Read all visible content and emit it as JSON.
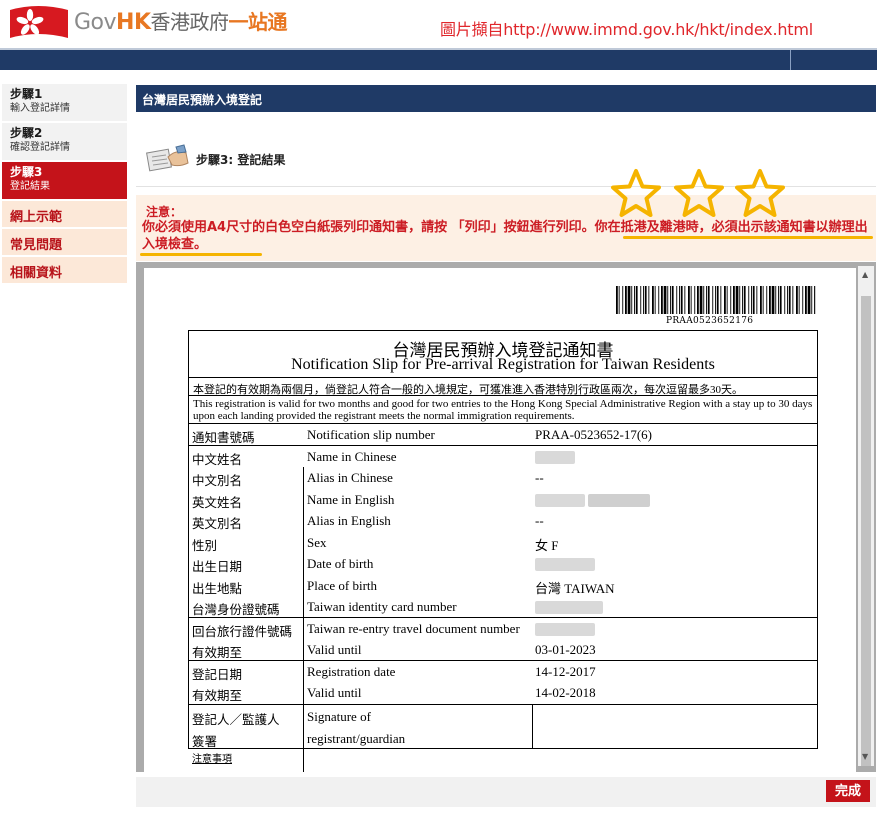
{
  "header": {
    "logo_gov": "Gov",
    "logo_hk": "HK",
    "logo_zh": "香港政府",
    "logo_zh2": "一站通",
    "source_note": "圖片擷自http://www.immd.gov.hk/hkt/index.html"
  },
  "sidebar": {
    "steps": [
      {
        "title": "步驟1",
        "sub": "輸入登記詳情"
      },
      {
        "title": "步驟2",
        "sub": "確認登記詳情"
      },
      {
        "title": "步驟3",
        "sub": "登記結果"
      }
    ],
    "links": [
      "網上示範",
      "常見問題",
      "相關資料"
    ]
  },
  "main": {
    "title_bar": "台灣居民預辦入境登記",
    "step_heading": "步驟3: 登記結果",
    "notice_title": "注意：",
    "notice_text": "你必須使用A4尺寸的白色空白紙張列印通知書，請按 「列印」按鈕進行列印。你在抵港及離港時，必須出示該通知書以辦理出入境檢查。"
  },
  "slip": {
    "barcode_number": "PRAA0523652176",
    "title_zh": "台灣居民預辦入境登記通知書",
    "title_en": "Notification Slip for Pre-arrival Registration for Taiwan Residents",
    "validity_zh": "本登記的有效期為兩個月，倘登記人符合一般的入境規定，可獲准進入香港特別行政區兩次，每次逗留最多30天。",
    "validity_en": "This registration is valid for two months and good for two entries to the Hong Kong Special Administrative Region with a stay up to 30 days upon each landing provided the registrant meets the normal immigration requirements.",
    "slip_number": {
      "zh": "通知書號碼",
      "en": "Notification slip number",
      "value": "PRAA-0523652-17(6)"
    },
    "personal": [
      {
        "zh": "中文姓名",
        "en": "Name in Chinese",
        "value": ""
      },
      {
        "zh": "中文別名",
        "en": "Alias in Chinese",
        "value": "--"
      },
      {
        "zh": "英文姓名",
        "en": "Name in English",
        "value": ""
      },
      {
        "zh": "英文別名",
        "en": "Alias in English",
        "value": "--"
      },
      {
        "zh": "性別",
        "en": "Sex",
        "value": "女 F"
      },
      {
        "zh": "出生日期",
        "en": "Date of birth",
        "value": ""
      },
      {
        "zh": "出生地點",
        "en": "Place of birth",
        "value": "台灣 TAIWAN"
      },
      {
        "zh": "台灣身份證號碼",
        "en": "Taiwan identity card number",
        "value": ""
      }
    ],
    "travel_doc": [
      {
        "zh": "回台旅行證件號碼",
        "en": "Taiwan re-entry travel document number",
        "value": ""
      },
      {
        "zh": "有效期至",
        "en": "Valid until",
        "value": "03-01-2023"
      }
    ],
    "registration": [
      {
        "zh": "登記日期",
        "en": "Registration date",
        "value": "14-12-2017"
      },
      {
        "zh": "有效期至",
        "en": "Valid until",
        "value": "14-02-2018"
      }
    ],
    "signature": {
      "zh1": "登記人／監護人",
      "zh2": "簽署",
      "en1": "Signature of",
      "en2": "registrant/guardian"
    },
    "notes_link": "注意事項"
  },
  "footer": {
    "done_label": "完成"
  },
  "colors": {
    "nav_blue": "#1f3a66",
    "accent_red": "#c4131a",
    "notice_bg": "#fdf0e4",
    "highlight": "#f5b400"
  },
  "icons": [
    "hk-flag-icon",
    "star-icon",
    "document-hand-icon"
  ]
}
